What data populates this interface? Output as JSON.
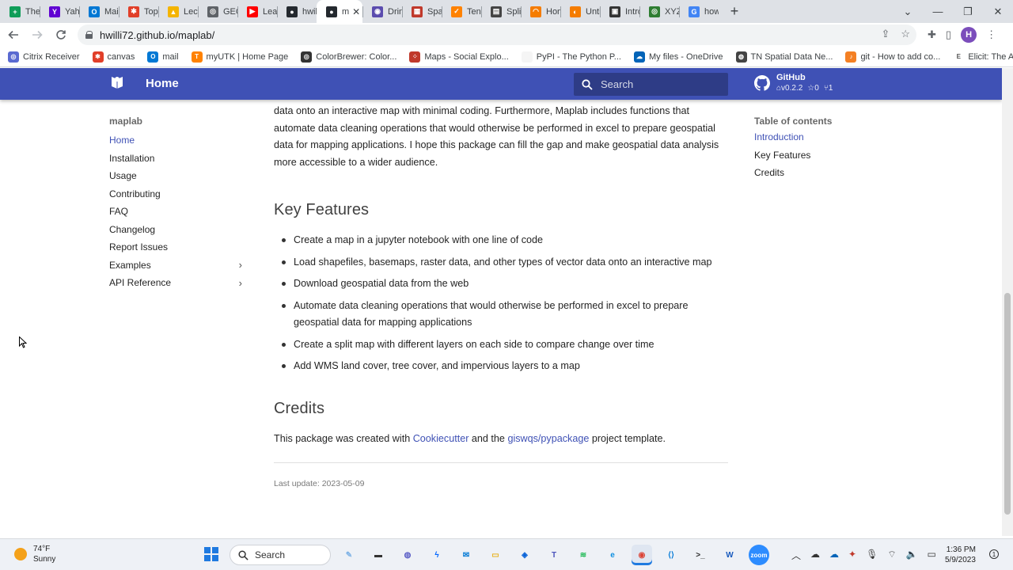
{
  "browser": {
    "tabs": [
      {
        "label": "The E",
        "icon": "sheets-icon",
        "color": "#0f9d58",
        "glyph": "+"
      },
      {
        "label": "Yahoo",
        "icon": "yahoo-icon",
        "color": "#6001d2",
        "glyph": "Y"
      },
      {
        "label": "Mail -",
        "icon": "outlook-icon",
        "color": "#0078d4",
        "glyph": "O"
      },
      {
        "label": "Topic",
        "icon": "canvas-icon",
        "color": "#e13f29",
        "glyph": "✱"
      },
      {
        "label": "Lectu",
        "icon": "drive-icon",
        "color": "#f4b400",
        "glyph": "▲"
      },
      {
        "label": "GEOG",
        "icon": "geog-icon",
        "color": "#5f6368",
        "glyph": "◎"
      },
      {
        "label": "Leafn",
        "icon": "youtube-icon",
        "color": "#ff0000",
        "glyph": "▶"
      },
      {
        "label": "hwilli",
        "icon": "github-icon",
        "color": "#24292f",
        "glyph": "●"
      },
      {
        "label": "m",
        "icon": "mkdocs-icon",
        "color": "#24292f",
        "glyph": "●",
        "active": true
      },
      {
        "label": "Drink",
        "icon": "drink-icon",
        "color": "#5b4cae",
        "glyph": "◉"
      },
      {
        "label": "Spati",
        "icon": "spatial-icon",
        "color": "#c0392b",
        "glyph": "▦"
      },
      {
        "label": "Tenne",
        "icon": "tennessee-icon",
        "color": "#ff8200",
        "glyph": "✓"
      },
      {
        "label": "SplitN",
        "icon": "splitmap-icon",
        "color": "#444444",
        "glyph": "▤"
      },
      {
        "label": "Home",
        "icon": "home-orange-icon",
        "color": "#f57c00",
        "glyph": "◠"
      },
      {
        "label": "Untitl",
        "icon": "untitled-icon",
        "color": "#f57c00",
        "glyph": "◐"
      },
      {
        "label": "Introc",
        "icon": "intro-icon",
        "color": "#333333",
        "glyph": "▣"
      },
      {
        "label": "XYZ T",
        "icon": "xyz-icon",
        "color": "#2e7d32",
        "glyph": "◎"
      },
      {
        "label": "how t",
        "icon": "google-icon",
        "color": "#4285f4",
        "glyph": "G"
      }
    ],
    "active_tab_close": "✕",
    "new_tab": "+",
    "url": "hwilli72.github.io/maplab/",
    "avatar_letter": "H",
    "bookmarks": [
      {
        "label": "Citrix Receiver",
        "color": "#5a6ad1",
        "glyph": "◎"
      },
      {
        "label": "canvas",
        "color": "#e13f29",
        "glyph": "✱"
      },
      {
        "label": "mail",
        "color": "#0078d4",
        "glyph": "O"
      },
      {
        "label": "myUTK | Home Page",
        "color": "#ff8200",
        "glyph": "T"
      },
      {
        "label": "ColorBrewer: Color...",
        "color": "#333333",
        "glyph": "◎"
      },
      {
        "label": "Maps - Social Explo...",
        "color": "#c0392b",
        "glyph": "⁘"
      },
      {
        "label": "PyPI - The Python P...",
        "color": "#f5f5f5",
        "glyph": ""
      },
      {
        "label": "My files - OneDrive",
        "color": "#0364b8",
        "glyph": "☁"
      },
      {
        "label": "TN Spatial Data Ne...",
        "color": "#444444",
        "glyph": "◍"
      },
      {
        "label": "git - How to add co...",
        "color": "#f48024",
        "glyph": "♪"
      },
      {
        "label": "Elicit: The AI Resear...",
        "color": "#ffffff",
        "glyph": "E"
      }
    ]
  },
  "header": {
    "title": "Home",
    "search_placeholder": "Search",
    "repo": {
      "name": "GitHub",
      "version": "v0.2.2",
      "stars": "0",
      "forks": "1"
    }
  },
  "nav": {
    "title": "maplab",
    "items": [
      {
        "label": "Home",
        "active": true,
        "expandable": false
      },
      {
        "label": "Installation",
        "active": false,
        "expandable": false
      },
      {
        "label": "Usage",
        "active": false,
        "expandable": false
      },
      {
        "label": "Contributing",
        "active": false,
        "expandable": false
      },
      {
        "label": "FAQ",
        "active": false,
        "expandable": false
      },
      {
        "label": "Changelog",
        "active": false,
        "expandable": false
      },
      {
        "label": "Report Issues",
        "active": false,
        "expandable": false
      },
      {
        "label": "Examples",
        "active": false,
        "expandable": true
      },
      {
        "label": "API Reference",
        "active": false,
        "expandable": true
      }
    ]
  },
  "content": {
    "intro_tail": "data onto an interactive map with minimal coding. Furthermore, Maplab includes functions that automate data cleaning operations that would otherwise be performed in excel to prepare geospatial data for mapping applications. I hope this package can fill the gap and make geospatial data analysis more accessible to a wider audience.",
    "key_features_heading": "Key Features",
    "features": [
      "Create a map in a jupyter notebook with one line of code",
      "Load shapefiles, basemaps, raster data, and other types of vector data onto an interactive map",
      "Download geospatial data from the web",
      "Automate data cleaning operations that would otherwise be performed in excel to prepare geospatial data for mapping applications",
      "Create a split map with different layers on each side to compare change over time",
      "Add WMS land cover, tree cover, and impervious layers to a map"
    ],
    "credits_heading": "Credits",
    "credits": {
      "prefix": "This package was created with ",
      "link1": "Cookiecutter",
      "middle": " and the ",
      "link2": "giswqs/pypackage",
      "suffix": " project template."
    },
    "last_update": "Last update: 2023-05-09"
  },
  "toc": {
    "title": "Table of contents",
    "items": [
      {
        "label": "Introduction",
        "active": true
      },
      {
        "label": "Key Features",
        "active": false
      },
      {
        "label": "Credits",
        "active": false
      }
    ]
  },
  "taskbar": {
    "weather_temp": "74°F",
    "weather_desc": "Sunny",
    "search_label": "Search",
    "apps": [
      {
        "name": "widgets-app",
        "color": "#7fb3e6",
        "glyph": "✎"
      },
      {
        "name": "file-explorer-app",
        "color": "#333333",
        "glyph": "▬"
      },
      {
        "name": "teams-chat-app",
        "color": "#5b5fc7",
        "glyph": "◍"
      },
      {
        "name": "powerautomate-app",
        "color": "#0066ff",
        "glyph": "ϟ"
      },
      {
        "name": "mail-app",
        "color": "#0078d4",
        "glyph": "✉"
      },
      {
        "name": "folder-app",
        "color": "#e8b21f",
        "glyph": "▭"
      },
      {
        "name": "defender-app",
        "color": "#0a64d8",
        "glyph": "◈"
      },
      {
        "name": "teams-app",
        "color": "#4b53bc",
        "glyph": "T"
      },
      {
        "name": "spotify-app",
        "color": "#1db954",
        "glyph": "≋"
      },
      {
        "name": "edge-app",
        "color": "#0c8ee0",
        "glyph": "e"
      },
      {
        "name": "chrome-app",
        "color": "#db4437",
        "glyph": "◉",
        "active": true
      },
      {
        "name": "vscode-app",
        "color": "#0078d7",
        "glyph": "⟨⟩"
      },
      {
        "name": "terminal-app",
        "color": "#2b2b2b",
        "glyph": ">_"
      },
      {
        "name": "word-app",
        "color": "#185abd",
        "glyph": "W"
      },
      {
        "name": "zoom-app",
        "color": "#2d8cff",
        "glyph": "zoom"
      }
    ],
    "time": "1:36 PM",
    "date": "5/9/2023"
  }
}
